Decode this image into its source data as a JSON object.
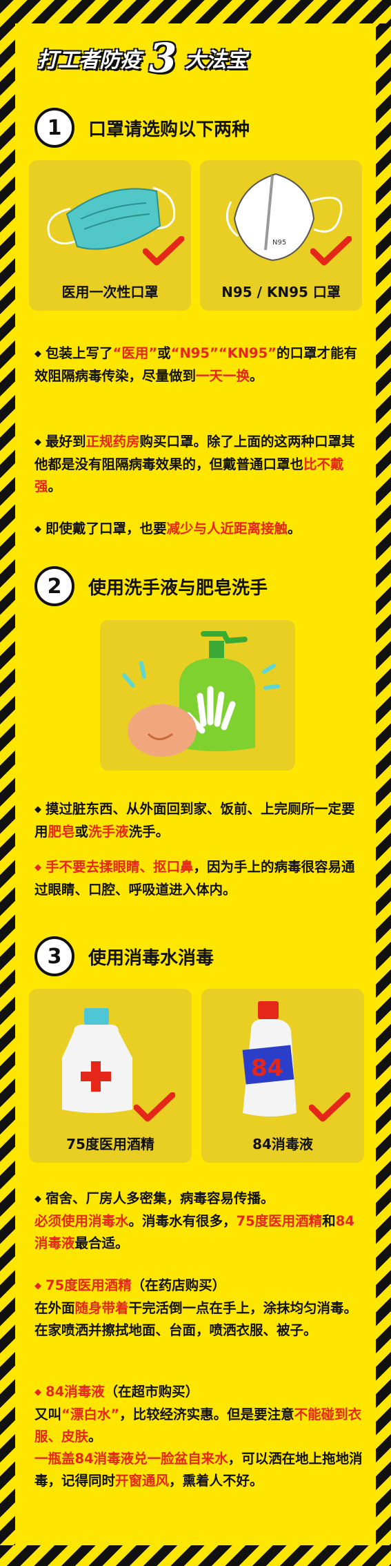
{
  "title": {
    "prefix": "打工者防疫",
    "number": "3",
    "suffix": "大法宝"
  },
  "sections": [
    {
      "num": "1",
      "heading": "口罩请选购以下两种",
      "cards": [
        "医用一次性口罩",
        "N95 / KN95 口罩"
      ],
      "mask_text": "N95",
      "paras": [
        [
          "包装上写了",
          "“医用”",
          "或",
          "“N95”",
          "“KN95”",
          "的口罩才能有效阻隔病毒传染，尽量做到",
          "一天一换",
          "。"
        ],
        [
          "最好到",
          "正规药房",
          "购买口罩。除了上面的这两种口罩其他都是没有阻隔病毒效果的，但戴普通口罩也",
          "比不戴强",
          "。"
        ],
        [
          "即使戴了口罩，也要",
          "减少与人近距离接触",
          "。"
        ]
      ]
    },
    {
      "num": "2",
      "heading": "使用洗手液与肥皂洗手",
      "paras": [
        [
          "摸过脏东西、从外面回到家、饭前、上完厕所一定要用",
          "肥皂",
          "或",
          "洗手液",
          "洗手。"
        ],
        [
          "手不要去揉眼睛、抠口鼻",
          "，因为手上的病毒很容易通过眼睛、口腔、呼吸道进入体内。"
        ]
      ]
    },
    {
      "num": "3",
      "heading": "使用消毒水消毒",
      "cards": [
        "75度医用酒精",
        "84消毒液"
      ],
      "bottle_text": "84",
      "paras": [
        [
          "宿舍、厂房人多密集，病毒容易传播。",
          "必须使用消毒水",
          "。消毒水有很多，",
          "75度医用酒精",
          "和",
          "84消毒液",
          "最合适。"
        ],
        [
          "75度医用酒精",
          "（在药店购买）",
          "在外面",
          "随身带着",
          "干完活倒一点在手上，涂抹均匀消毒。在家喷洒并擦拭地面、台面，喷洒衣服、被子。"
        ],
        [
          "84消毒液",
          "（在超市购买）",
          "又叫",
          "“漂白水”",
          "，比较经济实惠。但是要注意",
          "不能碰到衣服、皮肤",
          "。",
          "一瓶盖84消毒液兑一脸盆自来水",
          "，可以洒在地上拖地消毒，记得同时",
          "开窗通风",
          "，熏着人不好。"
        ]
      ]
    }
  ]
}
